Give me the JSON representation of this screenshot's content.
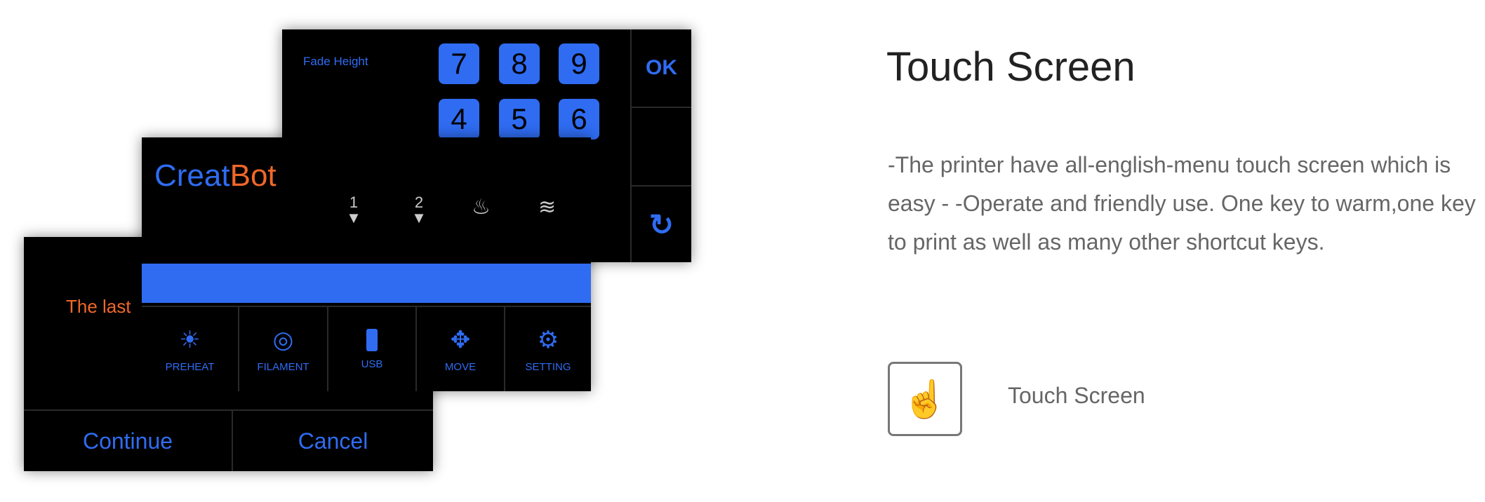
{
  "screens": {
    "keypad": {
      "label": "Fade Height",
      "keys": [
        "7",
        "8",
        "9",
        "4",
        "5",
        "6"
      ],
      "ok": "OK",
      "refresh_icon": "refresh-icon"
    },
    "main": {
      "logo": {
        "part1": "Creat",
        "part2": "Bot"
      },
      "status_icons": [
        "extruder-1-icon",
        "extruder-2-icon",
        "heated-bed-icon",
        "fan-icon"
      ],
      "extruder_numbers": [
        "1",
        "2"
      ],
      "menu": [
        {
          "label": "PREHEAT",
          "icon": "sun-icon"
        },
        {
          "label": "FILAMENT",
          "icon": "filament-spool-icon"
        },
        {
          "label": "USB",
          "icon": "usb-icon"
        },
        {
          "label": "MOVE",
          "icon": "move-arrows-icon"
        },
        {
          "label": "SETTING",
          "icon": "gear-icon"
        }
      ]
    },
    "resume": {
      "message": "The last",
      "continue": "Continue",
      "cancel": "Cancel"
    }
  },
  "colors": {
    "accent": "#2f6cf2",
    "orange": "#f0672a"
  },
  "content": {
    "title": "Touch Screen",
    "description": "-The printer have all-english-menu touch screen which is easy - -Operate and friendly use. One key to warm,one key to print as well as many other shortcut keys.",
    "feature": {
      "icon": "touch-hand-icon",
      "label": "Touch Screen"
    }
  }
}
